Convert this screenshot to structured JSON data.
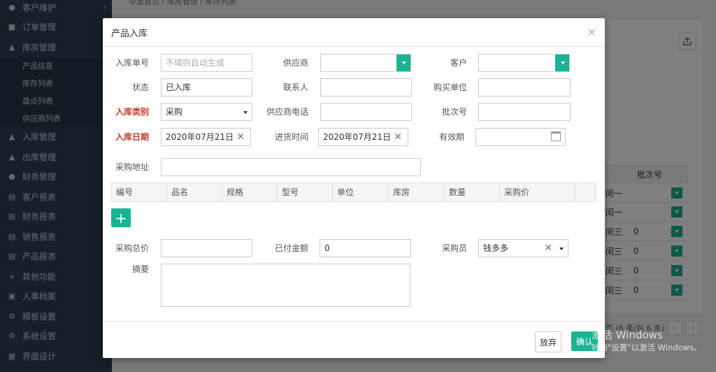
{
  "sidebar": {
    "items": [
      {
        "label": "客户维护",
        "icon": "user-icon"
      },
      {
        "label": "订单管理",
        "icon": "clipboard-icon"
      },
      {
        "label": "库房管理",
        "icon": "warehouse-icon"
      }
    ],
    "subitems": [
      "产品信息",
      "库存列表",
      "盘点列表",
      "供应商列表"
    ],
    "items2": [
      {
        "label": "入库管理",
        "icon": "warehouse-icon"
      },
      {
        "label": "出库管理",
        "icon": "warehouse-icon"
      },
      {
        "label": "财务管理",
        "icon": "money-icon"
      },
      {
        "label": "客户报表",
        "icon": "bar-chart-icon"
      },
      {
        "label": "财务报表",
        "icon": "bar-chart-icon"
      },
      {
        "label": "销售报表",
        "icon": "bar-chart-icon"
      },
      {
        "label": "产品报表",
        "icon": "bar-chart-icon"
      },
      {
        "label": "其他功能",
        "icon": "plus-icon"
      },
      {
        "label": "人事档案",
        "icon": "id-card-icon"
      },
      {
        "label": "模板设置",
        "icon": "gear-icon"
      },
      {
        "label": "系统设置",
        "icon": "gear-icon"
      },
      {
        "label": "界面设计",
        "icon": "layout-icon"
      }
    ],
    "collapse_glyph": "K"
  },
  "background": {
    "breadcrumb": "华道首页  /  库房管理  /  库存列表",
    "table_header": "批次号",
    "rows": [
      {
        "name": "闵一",
        "batch": ""
      },
      {
        "name": "闵一",
        "batch": ""
      },
      {
        "name": "闵三",
        "batch": "0"
      },
      {
        "name": "闵三",
        "batch": "0"
      },
      {
        "name": "闵三",
        "batch": "0"
      },
      {
        "name": "闵三",
        "batch": "0"
      }
    ],
    "pager_text": "页 (6 条/共 6 条)"
  },
  "watermark": {
    "line1": "激活 Windows",
    "line2": "转到\"设置\"以激活 Windows。"
  },
  "modal": {
    "title": "产品入库",
    "close_glyph": "×",
    "fields": {
      "order_no": {
        "label": "入库单号",
        "placeholder": "不填则自动生成",
        "value": ""
      },
      "supplier": {
        "label": "供应商",
        "value": ""
      },
      "customer": {
        "label": "客户",
        "value": ""
      },
      "status": {
        "label": "状态",
        "value": "已入库"
      },
      "contact": {
        "label": "联系人",
        "value": ""
      },
      "buyer_unit": {
        "label": "购买单位",
        "value": ""
      },
      "type": {
        "label": "入库类别",
        "value": "采购"
      },
      "supplier_phone": {
        "label": "供应商电话",
        "value": ""
      },
      "batch_no": {
        "label": "批次号",
        "value": ""
      },
      "date": {
        "label": "入库日期",
        "value": "2020年07月21日"
      },
      "purchase_time": {
        "label": "进货时间",
        "value": "2020年07月21日"
      },
      "expiry": {
        "label": "有效期",
        "value": ""
      },
      "address": {
        "label": "采购地址",
        "value": ""
      },
      "total": {
        "label": "采购总价",
        "value": ""
      },
      "paid": {
        "label": "已付金额",
        "value": "0"
      },
      "purchaser": {
        "label": "采购员",
        "value": "钱多多"
      },
      "summary": {
        "label": "摘要",
        "value": ""
      }
    },
    "table_columns": [
      "编号",
      "品名",
      "规格",
      "型号",
      "单位",
      "库房",
      "数量",
      "采购价",
      ""
    ],
    "add_glyph": "+",
    "cancel_label": "放弃",
    "ok_label": "确认"
  },
  "colors": {
    "accent": "#1ab394",
    "sidebar": "#2f4050",
    "required": "#c0392b"
  }
}
